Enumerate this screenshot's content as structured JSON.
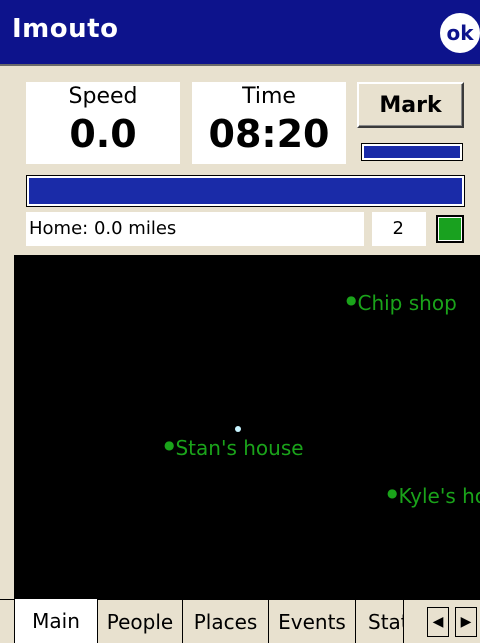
{
  "window": {
    "title": "Imouto",
    "ok_label": "ok"
  },
  "speed": {
    "label": "Speed",
    "value": "0.0"
  },
  "time": {
    "label": "Time",
    "value": "08:20"
  },
  "mark_button": {
    "label": "Mark"
  },
  "mini_progress": {
    "fraction": 1.0
  },
  "main_progress": {
    "fraction": 1.0
  },
  "home": {
    "text": "Home: 0.0 miles"
  },
  "count": {
    "value": "2"
  },
  "status_color": "#19a11f",
  "map": {
    "places": [
      {
        "name": "Chip shop"
      },
      {
        "name": "Stan's house"
      },
      {
        "name": "Kyle's house"
      }
    ]
  },
  "tabs": [
    {
      "label": "Main",
      "active": true
    },
    {
      "label": "People",
      "active": false
    },
    {
      "label": "Places",
      "active": false
    },
    {
      "label": "Events",
      "active": false
    },
    {
      "label": "Status",
      "active": false
    }
  ],
  "tab_scroll": {
    "left_icon": "arrow-left-icon",
    "right_icon": "arrow-right-icon"
  },
  "colors": {
    "titlebar": "#0d138c",
    "progress": "#1a2ba8",
    "place_text": "#1aa31a",
    "map_bg": "#000000",
    "window_bg": "#e8e1cf"
  }
}
